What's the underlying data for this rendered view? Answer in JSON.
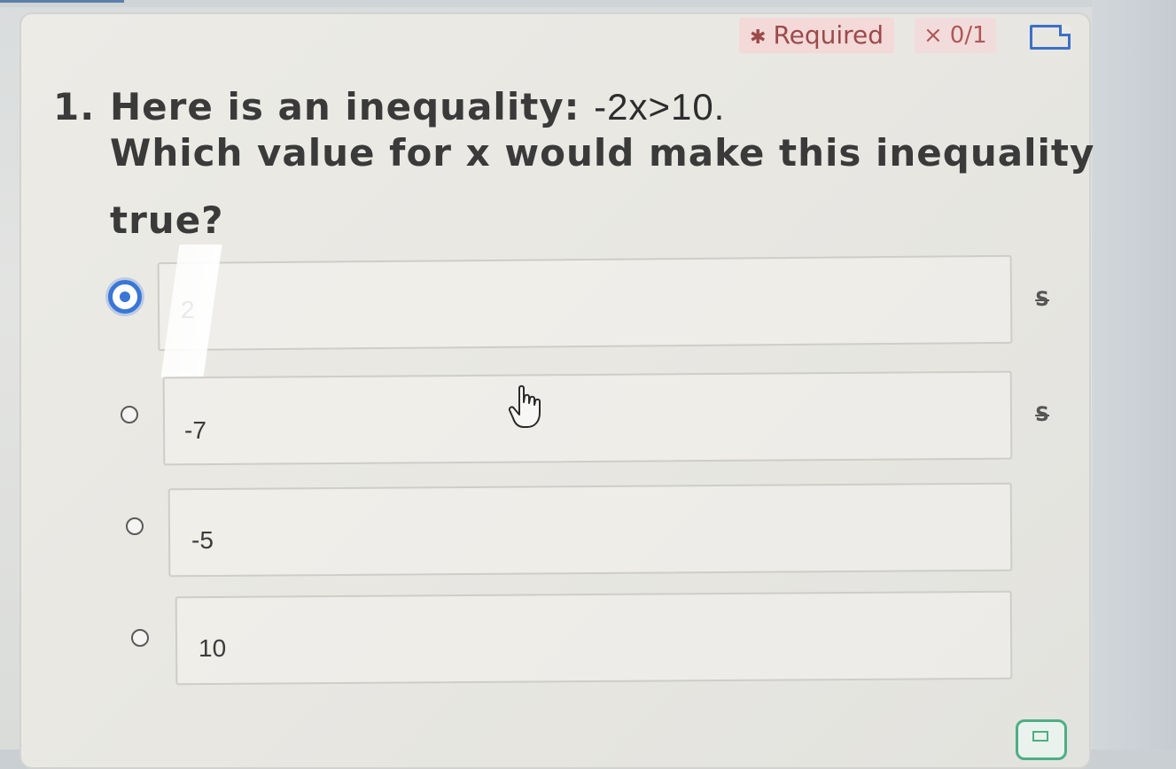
{
  "header": {
    "required_star": "✱",
    "required_label": "Required",
    "score_x": "×",
    "score": "0/1",
    "bookmark_icon": "bookmark-icon"
  },
  "question": {
    "number": "1.",
    "line1_text": "Here is an inequality: ",
    "line1_math": "-2x>10.",
    "line2": "Which value for x would make this inequality",
    "line3": "true?"
  },
  "options": [
    {
      "value": "2",
      "selected": true,
      "strike_icon": "S"
    },
    {
      "value": "-7",
      "selected": false,
      "strike_icon": "S"
    },
    {
      "value": "-5",
      "selected": false
    },
    {
      "value": "10",
      "selected": false
    }
  ],
  "colors": {
    "accent": "#3a76d6",
    "required_bg": "#f3d9d8",
    "required_text": "#9b4a4a",
    "score_text": "#b05757"
  }
}
